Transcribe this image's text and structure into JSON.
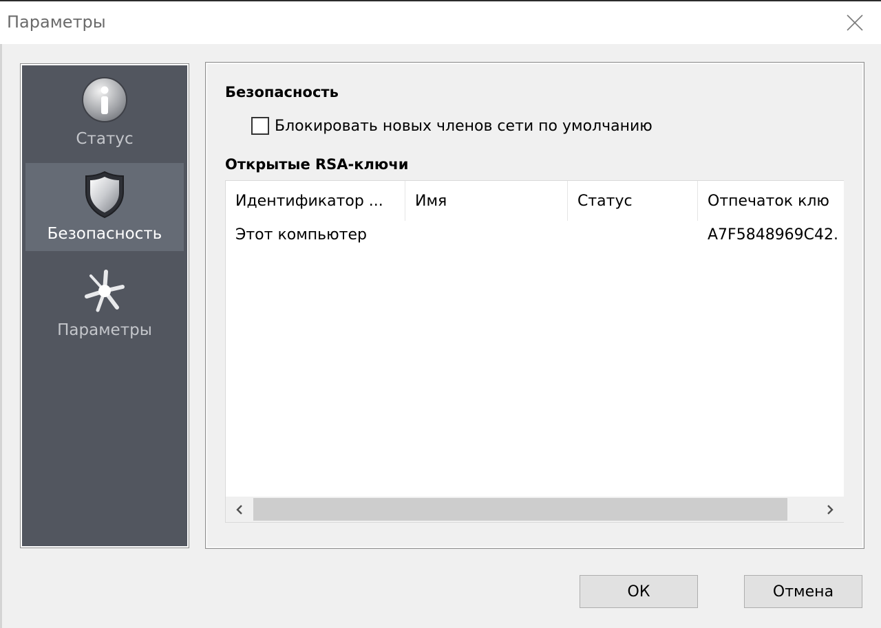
{
  "window": {
    "title": "Параметры"
  },
  "sidebar": {
    "items": [
      {
        "label": "Статус",
        "icon": "info-icon",
        "selected": false
      },
      {
        "label": "Безопасность",
        "icon": "shield-icon",
        "selected": true
      },
      {
        "label": "Параметры",
        "icon": "settings-burst-icon",
        "selected": false
      }
    ]
  },
  "security": {
    "title": "Безопасность",
    "block_new_members_label": "Блокировать новых членов сети по умолчанию",
    "block_new_members_checked": false
  },
  "rsa_keys": {
    "title": "Открытые RSA-ключи",
    "columns": [
      "Идентификатор ...",
      "Имя",
      "Статус",
      "Отпечаток клю"
    ],
    "rows": [
      [
        "Этот компьютер",
        "",
        "",
        "A7F5848969C42."
      ]
    ]
  },
  "buttons": {
    "ok": "ОК",
    "cancel": "Отмена"
  },
  "colors": {
    "sidebar_bg": "#52565f",
    "sidebar_selected": "#656b75",
    "button_bg": "#e1e1e1"
  }
}
